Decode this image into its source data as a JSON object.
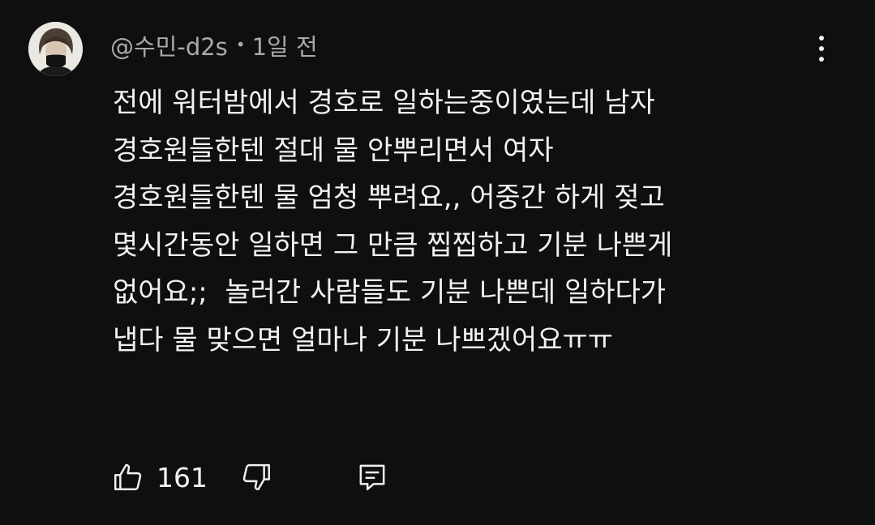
{
  "comment": {
    "author": "@수민-d2s",
    "separator": "•",
    "time": "1일 전",
    "lines": [
      "전에 워터밤에서 경호로 일하는중이였는데 남자",
      "경호원들한텐 절대 물 안뿌리면서 여자",
      "경호원들한텐 물 엄청 뿌려요,, 어중간 하게 젖고",
      "몇시간동안 일하면 그 만큼 찝찝하고 기분 나쁜게",
      "없어요;;  놀러간 사람들도 기분 나쁜데 일하다가",
      "냅다 물 맞으면 얼마나 기분 나쁘겠어요ㅠㅠ"
    ],
    "like_count": "161"
  },
  "icons": {
    "avatar": "avatar-image",
    "more": "more-vertical-icon",
    "like": "thumbs-up-icon",
    "dislike": "thumbs-down-icon",
    "reply": "reply-comment-icon"
  },
  "colors": {
    "background": "#0f0f0f",
    "text": "#f1f1f1",
    "secondary_text": "#aaaaaa"
  }
}
